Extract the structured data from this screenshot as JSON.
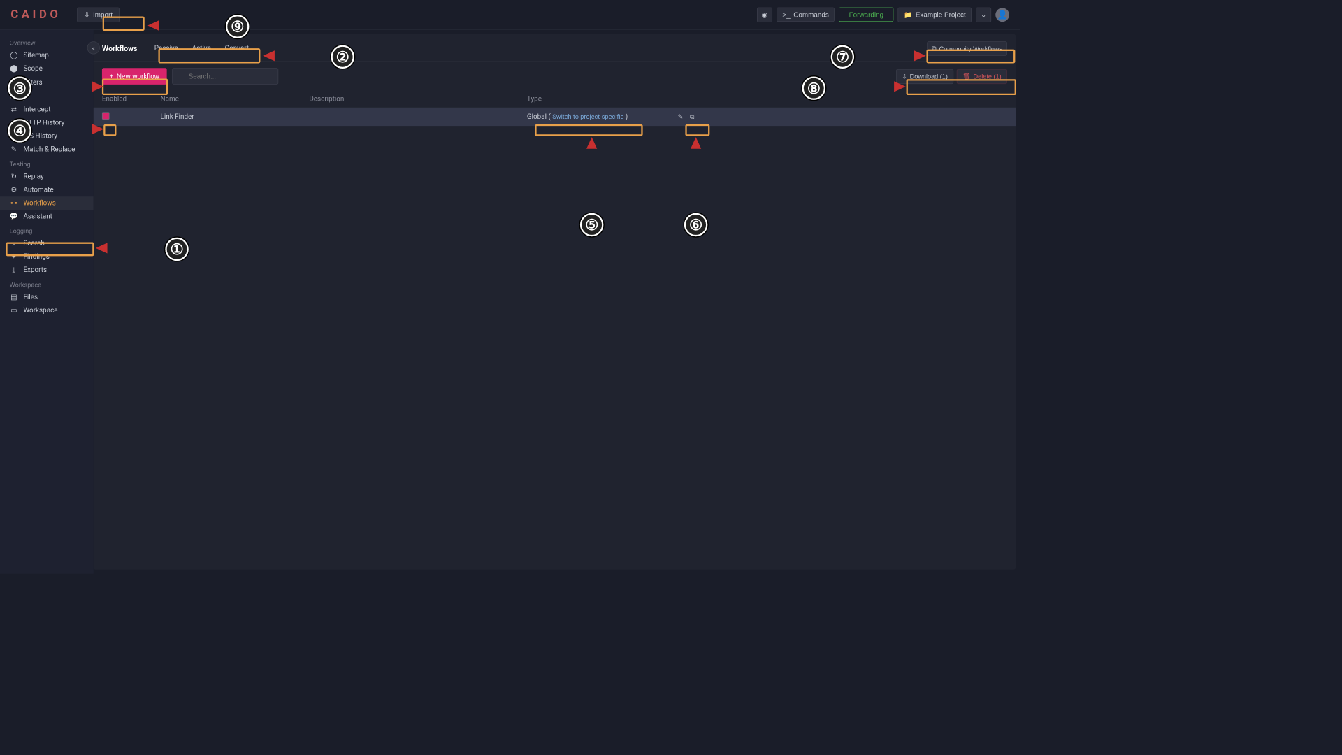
{
  "header": {
    "logo": "CAIDO",
    "import_label": "Import",
    "commands_label": "Commands",
    "forwarding_label": "Forwarding",
    "project_label": "Example Project"
  },
  "sidebar": {
    "sections": [
      {
        "title": "Overview",
        "items": [
          {
            "icon": "◯",
            "label": "Sitemap"
          },
          {
            "icon": "⬤",
            "label": "Scope"
          },
          {
            "icon": "≡",
            "label": "Filters"
          }
        ]
      },
      {
        "title": "Proxy",
        "items": [
          {
            "icon": "⇄",
            "label": "Intercept"
          },
          {
            "icon": "≣",
            "label": "HTTP History"
          },
          {
            "icon": "⇆",
            "label": "WS History"
          },
          {
            "icon": "✎",
            "label": "Match & Replace"
          }
        ]
      },
      {
        "title": "Testing",
        "items": [
          {
            "icon": "↻",
            "label": "Replay"
          },
          {
            "icon": "⚙",
            "label": "Automate"
          },
          {
            "icon": "⊶",
            "label": "Workflows",
            "active": true
          },
          {
            "icon": "💬",
            "label": "Assistant"
          }
        ]
      },
      {
        "title": "Logging",
        "items": [
          {
            "icon": "⌕",
            "label": "Search"
          },
          {
            "icon": "✦",
            "label": "Findings"
          },
          {
            "icon": "⤓",
            "label": "Exports"
          }
        ]
      },
      {
        "title": "Workspace",
        "items": [
          {
            "icon": "▤",
            "label": "Files"
          },
          {
            "icon": "▭",
            "label": "Workspace"
          }
        ]
      }
    ]
  },
  "tabbar": {
    "title": "Workflows",
    "tabs": [
      "Passive",
      "Active",
      "Convert"
    ],
    "community_label": "Community Workflows"
  },
  "toolbar": {
    "new_label": "New workflow",
    "search_placeholder": "Search...",
    "download_label": "Download (1)",
    "delete_label": "Delete (1)"
  },
  "table": {
    "headers": {
      "enabled": "Enabled",
      "name": "Name",
      "description": "Description",
      "type": "Type"
    },
    "rows": [
      {
        "enabled": true,
        "name": "Link Finder",
        "description": "",
        "type_prefix": "Global ( ",
        "type_link": "Switch to project-specific",
        "type_suffix": " )"
      }
    ]
  },
  "annotations": {
    "1": "①",
    "2": "②",
    "3": "③",
    "4": "④",
    "5": "⑤",
    "6": "⑥",
    "7": "⑦",
    "8": "⑧",
    "9": "⑨"
  }
}
